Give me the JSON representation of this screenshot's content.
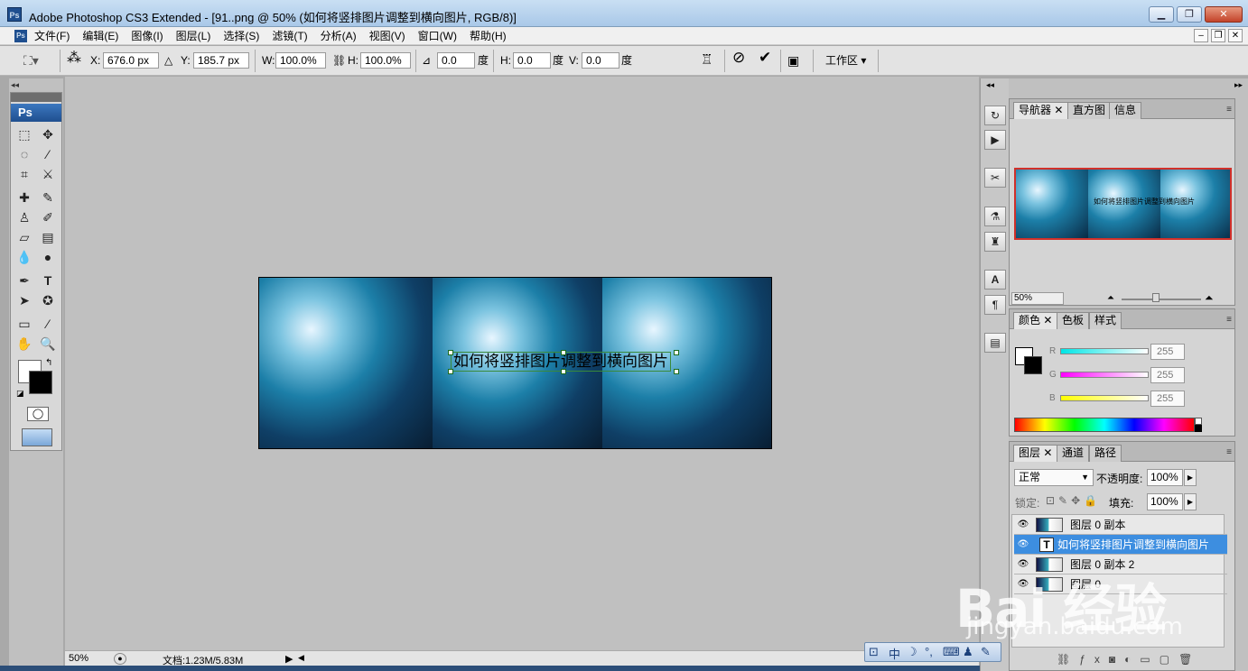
{
  "window": {
    "title": "Adobe Photoshop CS3 Extended - [91..png @ 50% (如何将竖排图片调整到横向图片, RGB/8)]",
    "app_icon": "Ps",
    "controls": [
      "minimize",
      "restore",
      "close"
    ]
  },
  "menubar": {
    "items": [
      "文件(F)",
      "编辑(E)",
      "图像(I)",
      "图层(L)",
      "选择(S)",
      "滤镜(T)",
      "分析(A)",
      "视图(V)",
      "窗口(W)",
      "帮助(H)"
    ]
  },
  "options": {
    "x_label": "X:",
    "x_value": "676.0 px",
    "y_label": "Y:",
    "y_value": "185.7 px",
    "w_label": "W:",
    "w_value": "100.0%",
    "h_label": "H:",
    "h_value": "100.0%",
    "angle_value": "0.0",
    "angle_unit": "度",
    "hskew_label": "H:",
    "hskew_value": "0.0",
    "hskew_unit": "度",
    "vskew_label": "V:",
    "vskew_value": "0.0",
    "vskew_unit": "度",
    "workspace_label": "工作区"
  },
  "canvas": {
    "text_layer_content": "如何将竖排图片调整到横向图片"
  },
  "statusbar": {
    "zoom": "50%",
    "doc_info": "文档:1.23M/5.83M"
  },
  "navigator": {
    "tabs": [
      "导航器",
      "直方图",
      "信息"
    ],
    "zoom": "50%",
    "thumb_text": "如何将竖排图片调整到横向图片"
  },
  "color_panel": {
    "tabs": [
      "颜色",
      "色板",
      "样式"
    ],
    "channels": [
      {
        "label": "R",
        "value": "255",
        "color": "#00e5e5"
      },
      {
        "label": "G",
        "value": "255",
        "color": "#ff00ff"
      },
      {
        "label": "B",
        "value": "255",
        "color": "#ffff00"
      }
    ]
  },
  "layers_panel": {
    "tabs": [
      "图层",
      "通道",
      "路径"
    ],
    "blend_mode": "正常",
    "opacity_label": "不透明度:",
    "opacity_value": "100%",
    "lock_label": "锁定:",
    "fill_label": "填充:",
    "fill_value": "100%",
    "layers": [
      {
        "name": "图层 0 副本",
        "type": "image",
        "selected": false
      },
      {
        "name": "如何将竖排图片调整到横向图片",
        "type": "text",
        "selected": true
      },
      {
        "name": "图层 0 副本 2",
        "type": "image",
        "selected": false
      },
      {
        "name": "图层 0",
        "type": "image",
        "selected": false
      }
    ]
  },
  "watermark": {
    "brand": "Bai 经验",
    "domain": "jingyan.baidu.com"
  },
  "ime": {
    "mode": "中"
  },
  "colors": {
    "canvas_bg": "#c0c0c0",
    "selected_layer": "#3d8ee0",
    "navigator_frame": "#d0302a"
  }
}
